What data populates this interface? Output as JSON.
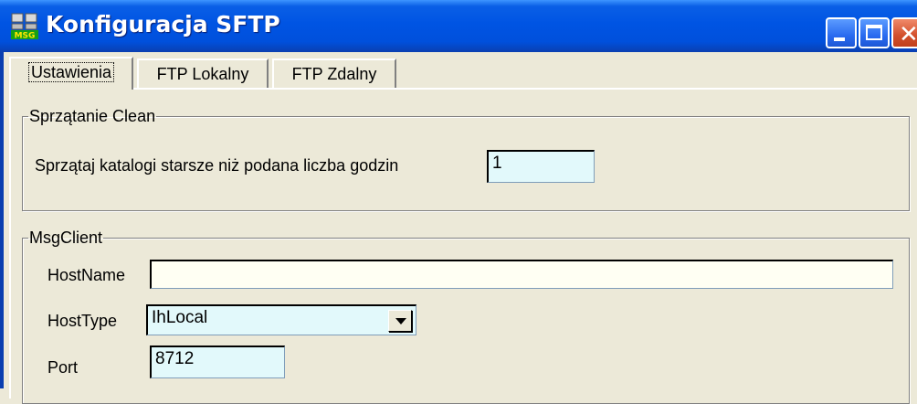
{
  "window": {
    "title": "Konfiguracja SFTP",
    "icon": "msg-app-icon",
    "title_bar_color": "#0054e3"
  },
  "tabs": [
    {
      "label": "Ustawienia",
      "active": true
    },
    {
      "label": "FTP Lokalny",
      "active": false
    },
    {
      "label": "FTP Zdalny",
      "active": false
    }
  ],
  "clean_group": {
    "legend": "Sprzątanie Clean",
    "hours_label": "Sprzątaj katalogi starsze niż podana liczba godzin",
    "hours_value": "1"
  },
  "msgclient_group": {
    "legend": "MsgClient",
    "hostname_label": "HostName",
    "hostname_value": "",
    "hosttype_label": "HostType",
    "hosttype_value": "IhLocal",
    "port_label": "Port",
    "port_value": "8712"
  },
  "colors": {
    "input_cyan": "#e2f9fb",
    "input_ivory": "#fffff3",
    "dialog_bg": "#ece9d8"
  }
}
